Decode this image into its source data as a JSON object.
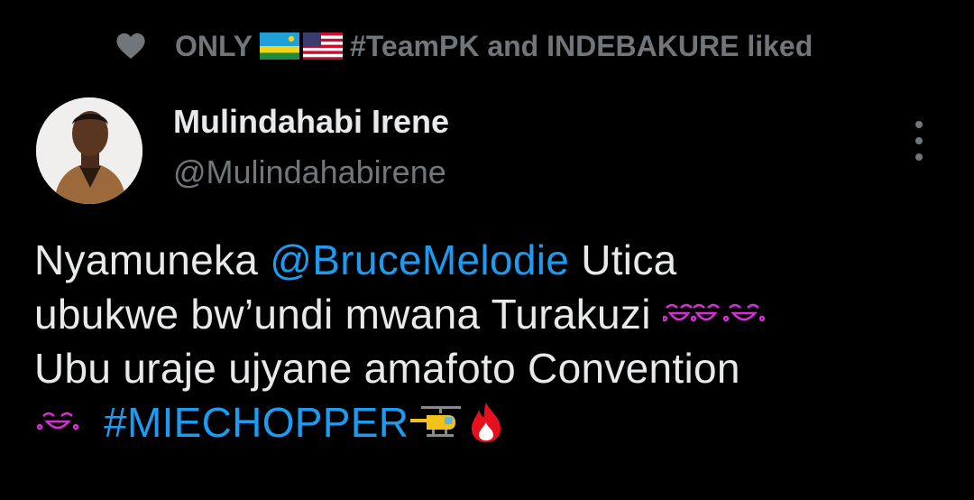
{
  "social_context": {
    "prefix": "ONLY",
    "suffix": "#TeamPK and INDEBAKURE liked",
    "flags": [
      "rwanda-flag-icon",
      "us-flag-icon"
    ]
  },
  "author": {
    "name": "Mulindahabi Irene",
    "handle": "@Mulindahabirene"
  },
  "tweet": {
    "line1_text": "Nyamuneka",
    "line1_mention": "@BruceMelodie",
    "line1_end": "Utica",
    "line2_text": "ubukwe bw’undi mwana Turakuzi",
    "line3_text": "Ubu uraje ujyane amafoto Convention",
    "line4_hashtag": "#MIECHOPPER"
  },
  "colors": {
    "link": "#1d9bf0",
    "secondary": "#71767b",
    "text": "#e7e9ea",
    "background": "#000000"
  },
  "icons": [
    "heart-icon",
    "more-options-icon",
    "laughing-face-icon",
    "helicopter-icon",
    "fire-icon"
  ]
}
